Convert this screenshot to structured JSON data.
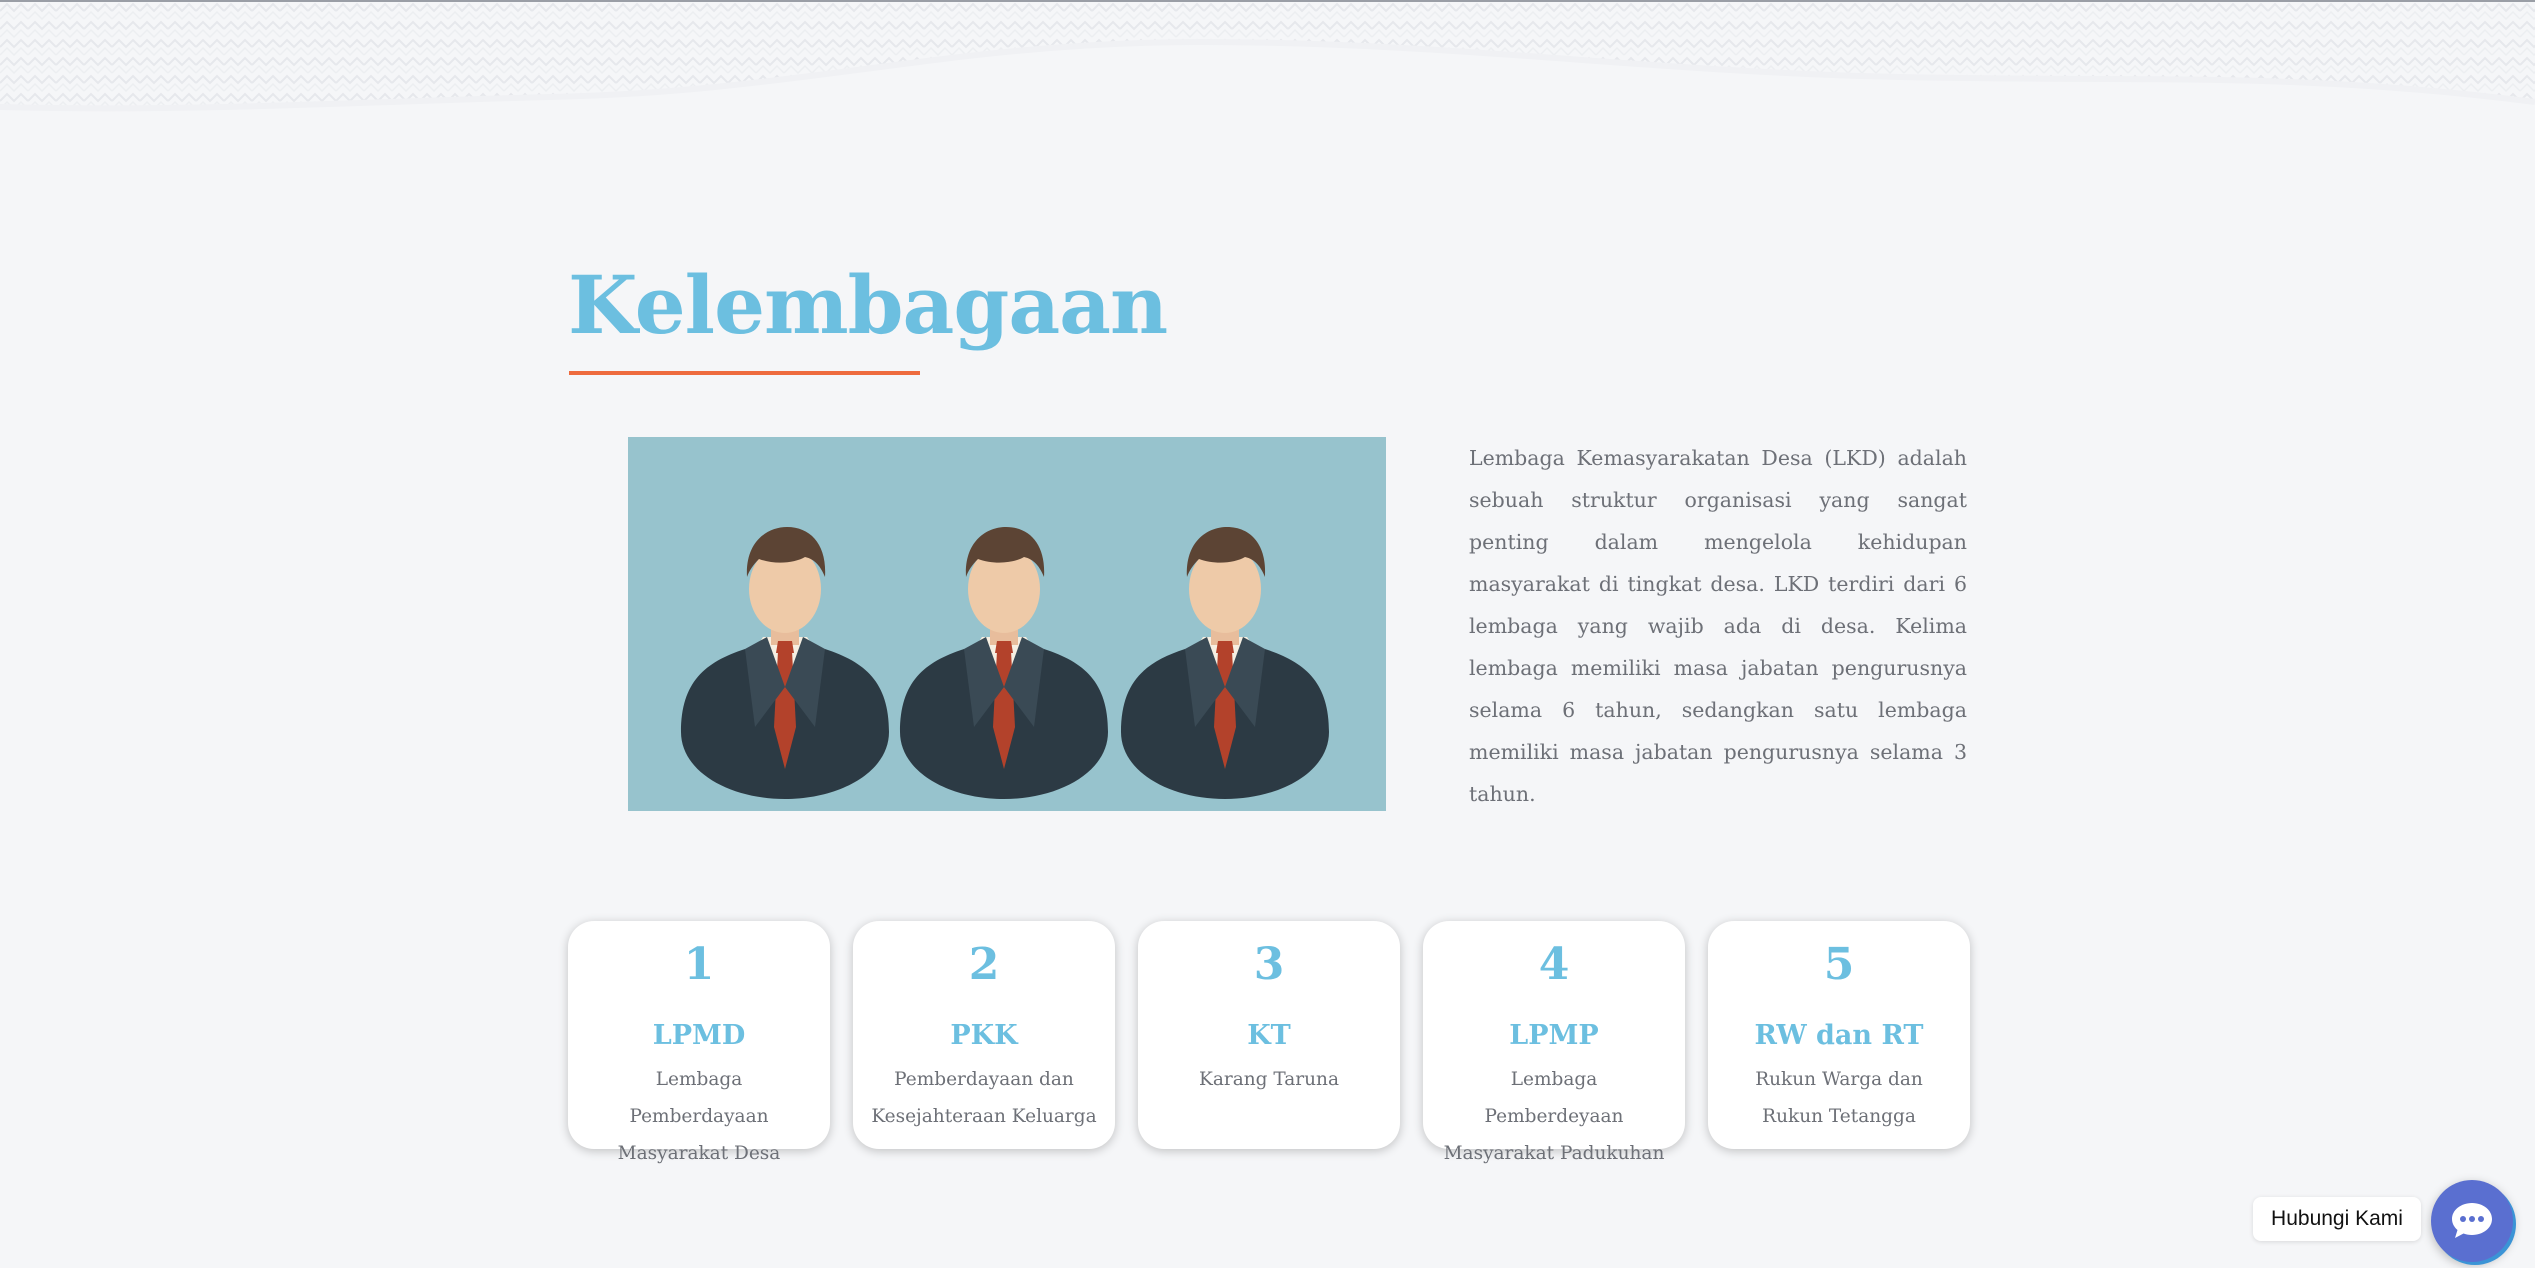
{
  "section": {
    "title": "Kelembagaan",
    "description": "Lembaga Kemasyarakatan Desa (LKD) adalah sebuah struktur organisasi yang sangat penting dalam mengelola kehidupan masyarakat di tingkat desa. LKD terdiri dari 6 lembaga yang wajib ada di desa. Kelima lembaga memiliki masa jabatan pengurusnya selama 6 tahun, sedangkan satu lembaga memiliki masa jabatan pengurusnya selama 3 tahun."
  },
  "cards": [
    {
      "number": "1",
      "title": "LPMD",
      "desc": "Lembaga Pemberdayaan Masyarakat Desa"
    },
    {
      "number": "2",
      "title": "PKK",
      "desc": "Pemberdayaan dan Kesejahteraan Keluarga"
    },
    {
      "number": "3",
      "title": "KT",
      "desc": "Karang Taruna"
    },
    {
      "number": "4",
      "title": "LPMP",
      "desc": "Lembaga Pemberdeyaan Masyarakat Padukuhan"
    },
    {
      "number": "5",
      "title": "RW dan RT",
      "desc": "Rukun Warga dan Rukun Tetangga"
    }
  ],
  "contact": {
    "label": "Hubungi Kami",
    "icon": "chat-bubble-icon"
  },
  "colors": {
    "accent": "#6cbfe0",
    "underline": "#ee6b3e",
    "background": "#f5f6f8",
    "illustration_bg": "#97c3cd",
    "text": "#6d7077",
    "contact_button": "#5a6fd0"
  },
  "illustration": {
    "icon": "three-businessmen-icon"
  }
}
